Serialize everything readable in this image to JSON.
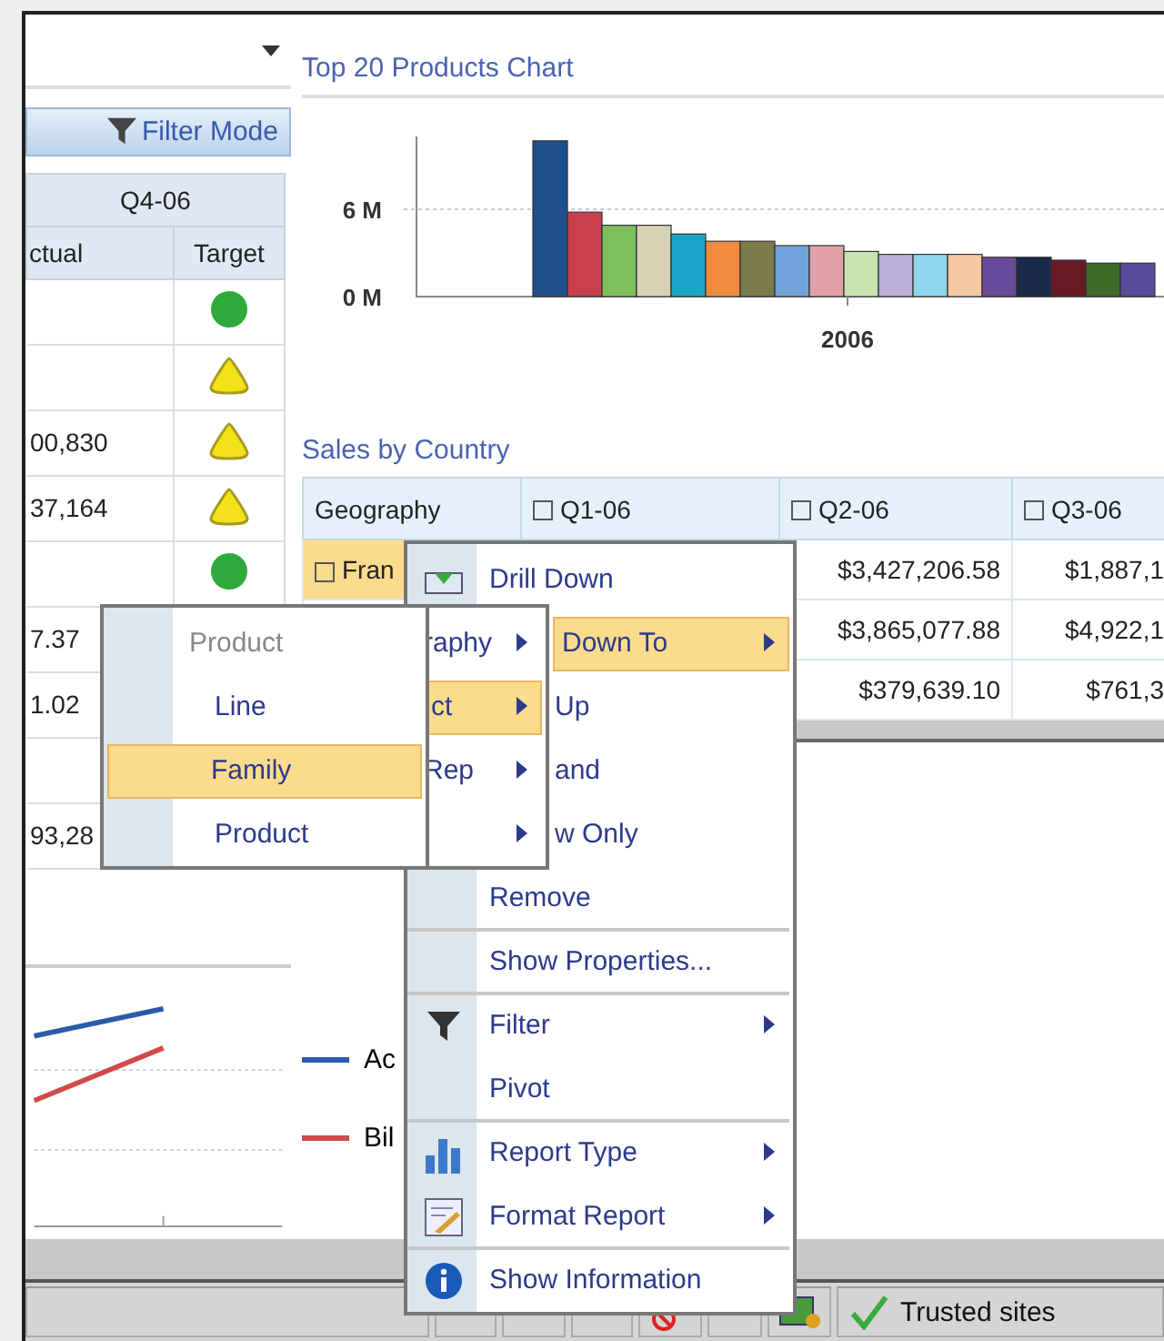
{
  "scorecard": {
    "filter_button": "Filter Mode",
    "period": "Q4-06",
    "columns": [
      "ctual",
      "Target"
    ],
    "rows": [
      {
        "actual": "",
        "target": {
          "kind": "circle",
          "color": "#2eaa3a"
        }
      },
      {
        "actual": "",
        "target": {
          "kind": "triangle",
          "color": "#f3e21a"
        }
      },
      {
        "actual": "00,830",
        "target": {
          "kind": "triangle",
          "color": "#f3e21a"
        }
      },
      {
        "actual": "37,164",
        "target": {
          "kind": "triangle",
          "color": "#f3e21a"
        }
      },
      {
        "actual": "",
        "target": {
          "kind": "circle",
          "color": "#2eaa3a"
        }
      },
      {
        "actual": "7.37"
      },
      {
        "actual": "1.02"
      },
      {
        "actual": ""
      },
      {
        "actual": "93,28"
      }
    ]
  },
  "top_chart": {
    "title": "Top 20 Products Chart",
    "chart_data": {
      "type": "bar",
      "categories": [
        "2006"
      ],
      "ylim": [
        0,
        11
      ],
      "yticks": [
        {
          "value": 0,
          "label": "0 M"
        },
        {
          "value": 6,
          "label": "6 M"
        }
      ],
      "series": [
        {
          "color": "#1f4e8c",
          "values": [
            10.7
          ]
        },
        {
          "color": "#c8404f",
          "values": [
            5.8
          ]
        },
        {
          "color": "#7dbf5a",
          "values": [
            4.9
          ]
        },
        {
          "color": "#d6d3b5",
          "values": [
            4.9
          ]
        },
        {
          "color": "#1ba6c9",
          "values": [
            4.3
          ]
        },
        {
          "color": "#f08a3c",
          "values": [
            3.8
          ]
        },
        {
          "color": "#7a7a4a",
          "values": [
            3.8
          ]
        },
        {
          "color": "#6fa2d8",
          "values": [
            3.5
          ]
        },
        {
          "color": "#e0a2a8",
          "values": [
            3.5
          ]
        },
        {
          "color": "#c7e3b0",
          "values": [
            3.1
          ]
        },
        {
          "color": "#bcb0d8",
          "values": [
            2.9
          ]
        },
        {
          "color": "#8fd6ec",
          "values": [
            2.9
          ]
        },
        {
          "color": "#f4c8a0",
          "values": [
            2.9
          ]
        },
        {
          "color": "#6a4a9c",
          "values": [
            2.7
          ]
        },
        {
          "color": "#1a2a4a",
          "values": [
            2.7
          ]
        },
        {
          "color": "#6a1a24",
          "values": [
            2.5
          ]
        },
        {
          "color": "#3e6a2a",
          "values": [
            2.3
          ]
        },
        {
          "color": "#5a4a9a",
          "values": [
            2.3
          ]
        }
      ]
    }
  },
  "sales_table": {
    "title": "Sales by Country",
    "columns": [
      "Geography",
      "Q1-06",
      "Q2-06",
      "Q3-06"
    ],
    "rows": [
      {
        "cells": [
          "Fran",
          "",
          "$3,427,206.58",
          "$1,887,1"
        ],
        "selected": true
      },
      {
        "cells": [
          "",
          "",
          "$3,865,077.88",
          "$4,922,1"
        ]
      },
      {
        "cells": [
          "",
          "",
          "$379,639.10",
          "$761,3"
        ]
      }
    ]
  },
  "line_chart": {
    "legend": [
      {
        "label": "Ac",
        "color": "#2a5aa8"
      },
      {
        "label": "Bil",
        "color": "#d04a4a"
      }
    ]
  },
  "context_menu": [
    {
      "label": "Drill Down",
      "selected": false,
      "covered": false,
      "submenu": false,
      "separator": false
    },
    {
      "label": "Down To",
      "selected": true,
      "covered": true,
      "submenu": true,
      "separator": false
    },
    {
      "label": "Up",
      "selected": false,
      "covered": true,
      "submenu": false,
      "separator": false
    },
    {
      "label": "and",
      "selected": false,
      "covered": true,
      "submenu": false,
      "separator": false
    },
    {
      "label": "w Only",
      "selected": false,
      "covered": true,
      "submenu": false,
      "separator": false
    },
    {
      "label": "Remove",
      "selected": false,
      "covered": false,
      "submenu": false,
      "separator": false
    },
    {
      "label": "Show Properties...",
      "selected": false,
      "covered": false,
      "submenu": false,
      "separator": true
    },
    {
      "label": "Filter",
      "selected": false,
      "covered": false,
      "submenu": true,
      "separator": true
    },
    {
      "label": "Pivot",
      "selected": false,
      "covered": false,
      "submenu": false,
      "separator": false
    },
    {
      "label": "Report Type",
      "selected": false,
      "covered": false,
      "submenu": true,
      "separator": true
    },
    {
      "label": "Format Report",
      "selected": false,
      "covered": false,
      "submenu": true,
      "separator": false
    },
    {
      "label": "Show Information",
      "selected": false,
      "covered": false,
      "submenu": false,
      "separator": true
    }
  ],
  "dimension_menu": [
    {
      "label": "raphy",
      "selected": false
    },
    {
      "label": "ct",
      "selected": true
    },
    {
      "label": "Rep",
      "selected": false
    },
    {
      "selected": false
    }
  ],
  "level_menu": {
    "header": "Product",
    "items": [
      {
        "label": "Line",
        "selected": false
      },
      {
        "label": "Family",
        "selected": true
      },
      {
        "label": "Product",
        "selected": false
      }
    ]
  },
  "status_bar": {
    "zone": "Trusted sites"
  }
}
